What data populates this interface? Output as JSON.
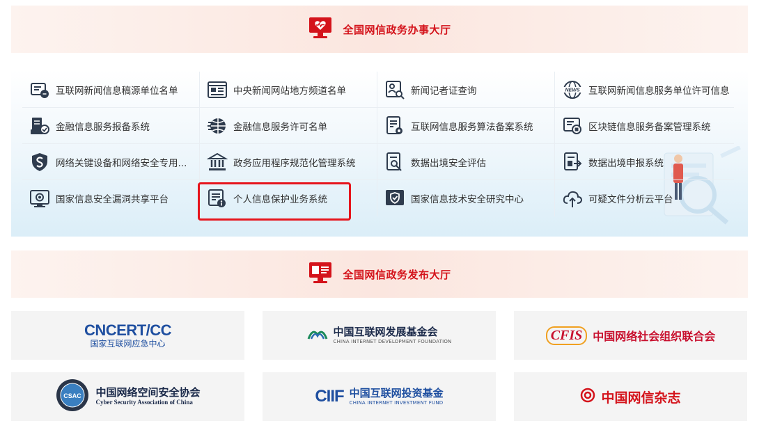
{
  "service_hall": {
    "title": "全国网信政务办事大厅"
  },
  "services": [
    {
      "label": "互联网新闻信息稿源单位名单",
      "icon": "news-source-icon"
    },
    {
      "label": "中央新闻网站地方频道名单",
      "icon": "website-list-icon"
    },
    {
      "label": "新闻记者证查询",
      "icon": "press-card-search-icon"
    },
    {
      "label": "互联网新闻信息服务单位许可信息",
      "icon": "news-globe-icon"
    },
    {
      "label": "金融信息服务报备系统",
      "icon": "finance-report-icon"
    },
    {
      "label": "金融信息服务许可名单",
      "icon": "finance-globe-icon"
    },
    {
      "label": "互联网信息服务算法备案系统",
      "icon": "algorithm-doc-icon"
    },
    {
      "label": "区块链信息服务备案管理系统",
      "icon": "blockchain-icon"
    },
    {
      "label": "网络关键设备和网络安全专用...",
      "icon": "shield-icon"
    },
    {
      "label": "政务应用程序规范化管理系统",
      "icon": "government-building-icon"
    },
    {
      "label": "数据出境安全评估",
      "icon": "data-assessment-icon"
    },
    {
      "label": "数据出境申报系统",
      "icon": "data-export-icon"
    },
    {
      "label": "国家信息安全漏洞共享平台",
      "icon": "vulnerability-monitor-icon"
    },
    {
      "label": "个人信息保护业务系统",
      "icon": "personal-info-icon"
    },
    {
      "label": "国家信息技术安全研究中心",
      "icon": "security-center-icon"
    },
    {
      "label": "可疑文件分析云平台",
      "icon": "cloud-upload-icon"
    }
  ],
  "publish_hall": {
    "title": "全国网信政务发布大厅"
  },
  "partners": [
    {
      "name_main": "CNCERT/CC",
      "name_cn": "国家互联网应急中心"
    },
    {
      "name_main": "中国互联网发展基金会",
      "name_en": "CHINA INTERNET DEVELOPMENT FOUNDATION"
    },
    {
      "name_logo": "CFIS",
      "name_main": "中国网络社会组织联合会"
    },
    {
      "name_main": "中国网络空间安全协会",
      "name_en": "Cyber Security Association of China",
      "seal": "CSAC"
    },
    {
      "name_logo": "CIIF",
      "name_main": "中国互联网投资基金",
      "name_en": "CHINA INTERNET INVESTMENT FUND"
    },
    {
      "name_main": "中国网信杂志"
    }
  ],
  "colors": {
    "accent_red": "#d4131b",
    "icon_dark": "#2f3c4e",
    "text": "#333333",
    "cert_blue": "#1f4fa0"
  }
}
